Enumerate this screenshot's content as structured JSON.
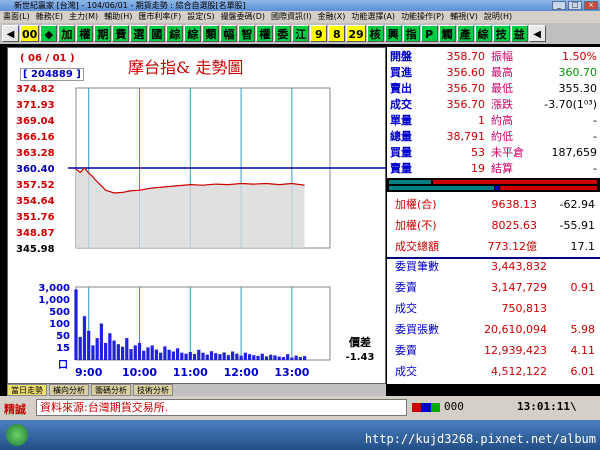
{
  "window": {
    "title": "新世紀贏家 [台灣] - 104/06/01 - 期貨走勢 : 綜合自選股[名單股]",
    "buttons": [
      "_",
      "□",
      "×"
    ]
  },
  "menu": [
    "畫面(L)",
    "雜務(E)",
    "主力(M)",
    "輔助(H)",
    "匯市利率(F)",
    "設定(S)",
    "撮盤委碼(D)",
    "國際資訊(I)",
    "金融(X)",
    "功能選擇(A)",
    "功能操作(P)",
    "輔視(V)",
    "說明(H)"
  ],
  "toolbar": [
    {
      "label": "◀",
      "kind": "nav"
    },
    {
      "label": "00",
      "kind": "num"
    },
    {
      "label": "◆",
      "kind": "sel"
    },
    {
      "label": "加",
      "kind": "sel"
    },
    {
      "label": "權",
      "kind": "sel"
    },
    {
      "label": "期",
      "kind": "sel"
    },
    {
      "label": "費",
      "kind": "sel"
    },
    {
      "label": "選",
      "kind": "sel"
    },
    {
      "label": "國",
      "kind": "sel"
    },
    {
      "label": "綜",
      "kind": "sel"
    },
    {
      "label": "綜",
      "kind": "sel"
    },
    {
      "label": "類",
      "kind": "sel"
    },
    {
      "label": "幅",
      "kind": "sel"
    },
    {
      "label": "智",
      "kind": "sel"
    },
    {
      "label": "權",
      "kind": "sel"
    },
    {
      "label": "委",
      "kind": "sel"
    },
    {
      "label": "江",
      "kind": "sel"
    },
    {
      "label": "9",
      "kind": "num"
    },
    {
      "label": "8",
      "kind": "num"
    },
    {
      "label": "29",
      "kind": "num"
    },
    {
      "label": "核",
      "kind": "sel"
    },
    {
      "label": "興",
      "kind": "sel"
    },
    {
      "label": "指",
      "kind": "sel"
    },
    {
      "label": "P",
      "kind": "sel"
    },
    {
      "label": "觸",
      "kind": "sel"
    },
    {
      "label": "產",
      "kind": "sel"
    },
    {
      "label": "綜",
      "kind": "sel"
    },
    {
      "label": "技",
      "kind": "sel"
    },
    {
      "label": "益",
      "kind": "sel"
    },
    {
      "label": "◀",
      "kind": "nav"
    }
  ],
  "chart": {
    "date": "( 06 / 01 )",
    "code": "[ 204889 ]",
    "title": "摩台指&  走勢圖",
    "price_diff_label": "價差",
    "price_diff_value": "-1.43",
    "unit_label": "口"
  },
  "chart_data": {
    "type": "line",
    "title": "摩台指&  走勢圖",
    "price_ticks": [
      "374.82",
      "371.93",
      "369.04",
      "366.16",
      "363.28",
      "360.40",
      "357.52",
      "354.64",
      "351.76",
      "348.87",
      "345.98"
    ],
    "price_range": [
      345.98,
      374.82
    ],
    "reference_price": 360.4,
    "volume_ticks": [
      "3,000",
      "1,000",
      "500",
      "100",
      "50",
      "15"
    ],
    "x_ticks": [
      "9:00",
      "10:00",
      "11:00",
      "12:00",
      "13:00"
    ],
    "x_range_minutes": [
      525,
      825
    ],
    "price_series": {
      "minutes": [
        525,
        530,
        535,
        540,
        545,
        550,
        555,
        560,
        570,
        580,
        590,
        600,
        615,
        630,
        645,
        660,
        675,
        690,
        705,
        720,
        735,
        750,
        765,
        780,
        795
      ],
      "values": [
        360.2,
        359.6,
        360.4,
        359.5,
        358.8,
        357.9,
        357.2,
        356.4,
        355.9,
        356.0,
        356.3,
        356.4,
        356.8,
        357.0,
        357.2,
        357.4,
        357.3,
        357.5,
        357.4,
        357.6,
        357.5,
        357.6,
        357.4,
        357.6,
        357.3
      ]
    },
    "volume_series": {
      "minutes": [
        525,
        530,
        535,
        540,
        545,
        550,
        555,
        560,
        565,
        570,
        575,
        580,
        585,
        590,
        595,
        600,
        605,
        610,
        615,
        620,
        625,
        630,
        635,
        640,
        645,
        650,
        655,
        660,
        665,
        670,
        675,
        680,
        685,
        690,
        695,
        700,
        705,
        710,
        715,
        720,
        725,
        730,
        735,
        740,
        745,
        750,
        755,
        760,
        765,
        770,
        775,
        780,
        785,
        790,
        795
      ],
      "values": [
        2900,
        950,
        1800,
        1200,
        600,
        900,
        1500,
        700,
        1100,
        800,
        650,
        550,
        900,
        450,
        600,
        700,
        380,
        520,
        600,
        430,
        300,
        560,
        420,
        350,
        480,
        300,
        260,
        330,
        250,
        420,
        300,
        220,
        360,
        280,
        240,
        310,
        200,
        350,
        260,
        180,
        300,
        240,
        200,
        170,
        260,
        150,
        220,
        190,
        140,
        120,
        240,
        100,
        180,
        120,
        160
      ]
    }
  },
  "quote": {
    "rows": [
      {
        "l1": "開盤",
        "v1": "358.70",
        "l2": "振幅",
        "v2": "1.50%",
        "c2": "qred"
      },
      {
        "l1": "買進",
        "v1": "356.60",
        "l2": "最高",
        "v2": "360.70",
        "c2": "qgreen"
      },
      {
        "l1": "賣出",
        "v1": "356.70",
        "l2": "最低",
        "v2": "355.30",
        "c2": "qblack"
      },
      {
        "l1": "成交",
        "v1": "356.70",
        "l2": "漲跌",
        "v2": "-3.70(1⁰³)",
        "c2": "qblack"
      },
      {
        "l1": "單量",
        "v1": "1",
        "l2": "約高",
        "v2": "-",
        "c2": "qblack"
      },
      {
        "l1": "總量",
        "v1": "38,791",
        "l2": "約低",
        "v2": "-",
        "c2": "qblack"
      },
      {
        "l1": "買量",
        "v1": "53",
        "l2": "未平倉",
        "v2": "187,659",
        "c2": "qblack"
      },
      {
        "l1": "賣量",
        "v1": "19",
        "l2": "結算",
        "v2": "-",
        "c2": "qblack"
      }
    ],
    "index_rows": [
      {
        "label": "加權(合)",
        "value": "9638.13",
        "change": "-62.94"
      },
      {
        "label": "加權(不)",
        "value": "8025.63",
        "change": "-55.91"
      },
      {
        "label": "成交總額",
        "value": "773.12億",
        "change": "17.1"
      }
    ],
    "order_rows": [
      {
        "label": "委買筆數",
        "value": "3,443,832",
        "change": ""
      },
      {
        "label": "委賣",
        "value": "3,147,729",
        "change": "0.91"
      },
      {
        "label": "成交",
        "value": "750,813",
        "change": ""
      },
      {
        "label": "委買張數",
        "value": "20,610,094",
        "change": "5.98"
      },
      {
        "label": "委賣",
        "value": "12,939,423",
        "change": "4.11"
      },
      {
        "label": "成交",
        "value": "4,512,122",
        "change": "6.01"
      }
    ]
  },
  "subtabs": [
    "當日走勢",
    "橫向分析",
    "籌碼分析",
    "技術分析"
  ],
  "infobar": {
    "label": "精誠",
    "source": "資料來源:台灣期貨交易所.",
    "volume": "000",
    "clock": "13:01:11\\"
  },
  "taskbar": {
    "watermark": "http://kujd3268.pixnet.net/album"
  },
  "colors": {
    "up": "#cc0000",
    "down": "#009900",
    "volume_bar": "#2222dd",
    "reference_line": "#0000aa",
    "price_line": "#cc0000"
  }
}
